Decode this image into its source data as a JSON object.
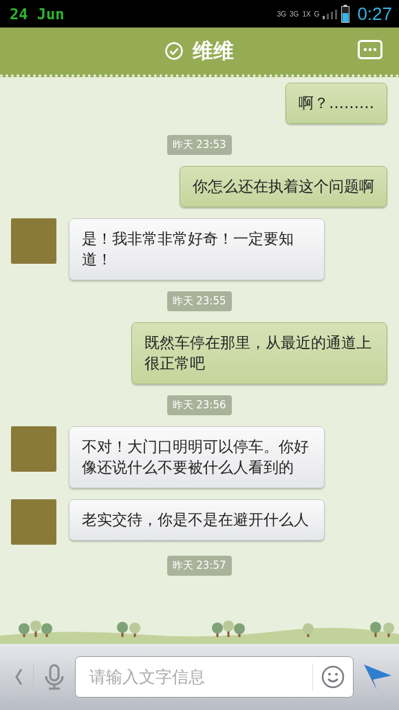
{
  "status_bar": {
    "date": "24 Jun",
    "network_labels": [
      "3G",
      "3G",
      "1X",
      "G"
    ],
    "time": "0:27"
  },
  "header": {
    "title": "维维",
    "online": true
  },
  "messages": [
    {
      "kind": "sent",
      "text": "啊？………"
    },
    {
      "kind": "time",
      "text": "昨天 23:53"
    },
    {
      "kind": "sent",
      "text": "你怎么还在执着这个问题啊"
    },
    {
      "kind": "received",
      "text": "是！我非常非常好奇！一定要知道！"
    },
    {
      "kind": "time",
      "text": "昨天 23:55"
    },
    {
      "kind": "sent",
      "text": "既然车停在那里，从最近的通道上很正常吧"
    },
    {
      "kind": "time",
      "text": "昨天 23:56"
    },
    {
      "kind": "received",
      "text": "不对！大门口明明可以停车。你好像还说什么不要被什么人看到的"
    },
    {
      "kind": "received",
      "text": "老实交待，你是不是在避开什么人"
    },
    {
      "kind": "time",
      "text": "昨天 23:57"
    }
  ],
  "input": {
    "placeholder": "请输入文字信息"
  }
}
